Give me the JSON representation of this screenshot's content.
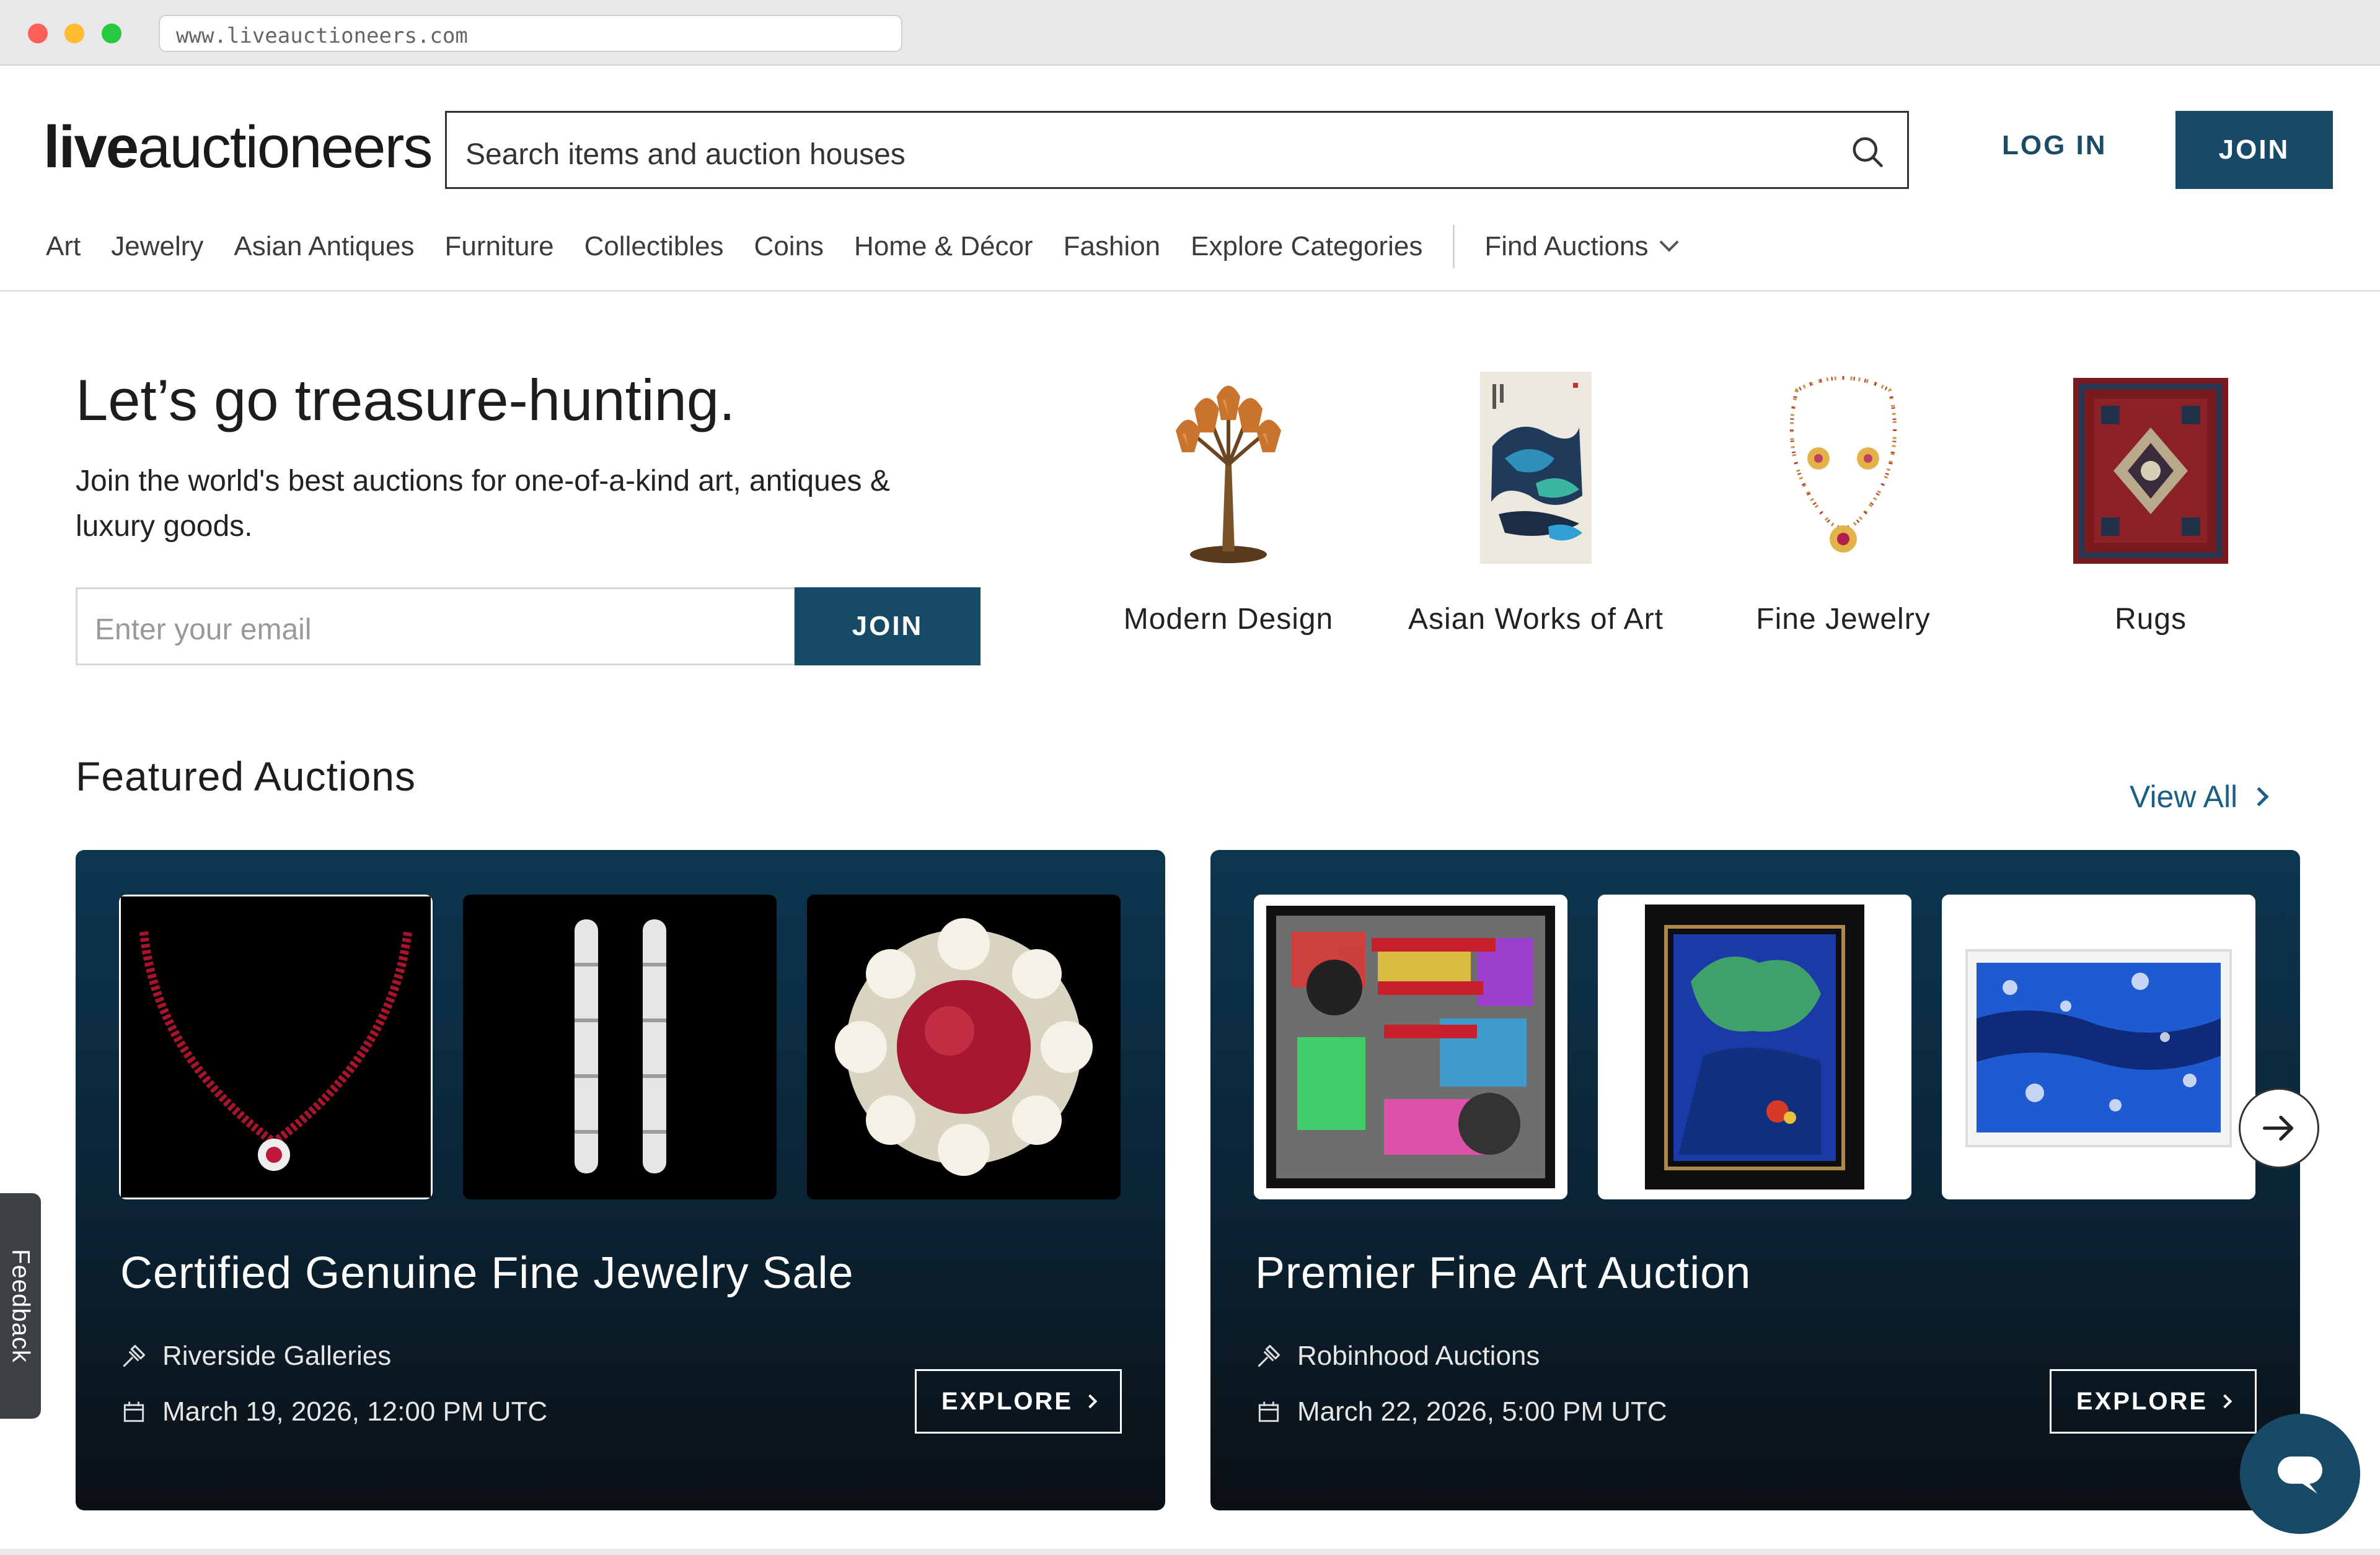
{
  "browser": {
    "url": "www.liveauctioneers.com"
  },
  "header": {
    "logo_bold": "live",
    "logo_rest": "auctioneers",
    "search_placeholder": "Search items and auction houses",
    "login_label": "LOG IN",
    "join_label": "JOIN"
  },
  "nav": {
    "items": [
      "Art",
      "Jewelry",
      "Asian Antiques",
      "Furniture",
      "Collectibles",
      "Coins",
      "Home & Décor",
      "Fashion",
      "Explore Categories"
    ],
    "find_auctions": "Find Auctions"
  },
  "hero": {
    "title": "Let’s go treasure-hunting.",
    "subtitle": "Join the world's best auctions for one-of-a-kind art, antiques & luxury goods.",
    "email_placeholder": "Enter your email",
    "join_label": "JOIN",
    "categories": [
      {
        "label": "Modern Design",
        "icon": "lamp-image"
      },
      {
        "label": "Asian Works of Art",
        "icon": "ink-painting-image"
      },
      {
        "label": "Fine Jewelry",
        "icon": "necklace-image"
      },
      {
        "label": "Rugs",
        "icon": "rug-image"
      }
    ]
  },
  "featured": {
    "title": "Featured Auctions",
    "view_all": "View All",
    "auctions": [
      {
        "title": "Certified Genuine Fine Jewelry Sale",
        "house": "Riverside Galleries",
        "date": "March 19, 2026, 12:00 PM UTC",
        "explore": "EXPLORE"
      },
      {
        "title": "Premier Fine Art Auction",
        "house": "Robinhood Auctions",
        "date": "March 22, 2026, 5:00 PM UTC",
        "explore": "EXPLORE"
      }
    ]
  },
  "feedback_label": "Feedback",
  "colors": {
    "primary": "#174a66",
    "link": "#1b5f86",
    "card_top": "#0c3650",
    "card_bottom": "#0b1014"
  }
}
